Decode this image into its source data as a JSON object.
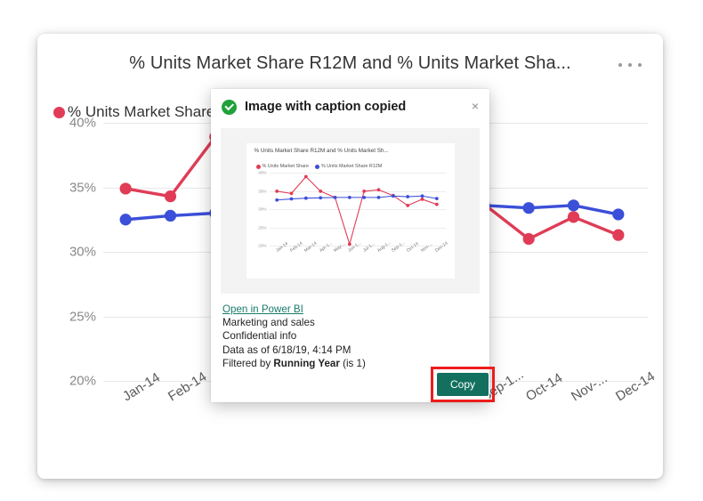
{
  "report": {
    "title": "% Units Market Share R12M and % Units Market Sha...",
    "menu_label": "More options",
    "legend": [
      {
        "label": "% Units Market Share",
        "color": "#E03C56"
      },
      {
        "label": "% Units Market Share R12M",
        "color": "#3B4FD8"
      }
    ]
  },
  "dialog": {
    "title": "Image with caption copied",
    "close_label": "×",
    "success_icon": "check-circle-icon",
    "caption": {
      "link": "Open in Power BI",
      "line1": "Marketing and sales",
      "line2": "Confidential info",
      "line3": "Data as of 6/18/19, 4:14 PM",
      "filter_prefix": "Filtered by ",
      "filter_name": "Running Year",
      "filter_suffix": " (is 1)"
    },
    "copy_label": "Copy",
    "highlight_color": "#EE1C1C",
    "button_color": "#13705F"
  },
  "chart_data": {
    "type": "line",
    "title": "% Units Market Share R12M and % Units Market Sh...",
    "xlabel": "",
    "ylabel": "",
    "ylim": [
      20,
      40
    ],
    "yticks": [
      40,
      35,
      30,
      25,
      20
    ],
    "ytick_labels": [
      "40%",
      "35%",
      "30%",
      "25%",
      "20%"
    ],
    "grid": true,
    "legend_position": "top-left",
    "categories": [
      "Jan-14",
      "Feb-14",
      "Mar-14",
      "Apr-14",
      "May-14",
      "Jun-14",
      "Jul-14",
      "Aug-14",
      "Sep-14",
      "Oct-14",
      "Nov-14",
      "Dec-14"
    ],
    "categories_display": [
      "Jan-14",
      "Feb-14",
      "Mar-14",
      "Apr-1...",
      "May-...",
      "Jun-1...",
      "Jul-1...",
      "Aug-1...",
      "Sep-1...",
      "Oct-14",
      "Nov-...",
      "Dec-14"
    ],
    "series": [
      {
        "name": "% Units Market Share",
        "color": "#E03C56",
        "values": [
          34.9,
          34.3,
          38.9,
          34.9,
          33.2,
          20.4,
          34.9,
          35.3,
          33.7,
          31.0,
          32.7,
          31.3
        ]
      },
      {
        "name": "% Units Market Share R12M",
        "color": "#3B4FD8",
        "values": [
          32.5,
          32.8,
          33.0,
          33.1,
          33.2,
          33.2,
          33.2,
          33.2,
          33.6,
          33.4,
          33.6,
          32.9
        ]
      }
    ]
  }
}
